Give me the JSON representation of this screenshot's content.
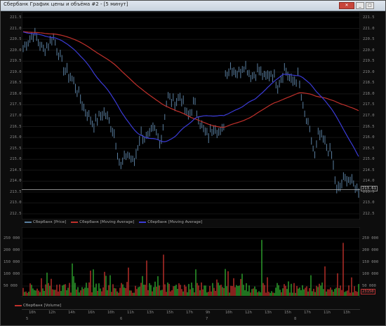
{
  "window": {
    "title": "Сбербанк График цены и объёма #2 - [5 минут]",
    "btn_min": "_",
    "btn_max": "□",
    "btn_close": "✕"
  },
  "price_panel": {
    "y_ticks": [
      "221.5",
      "221.0",
      "220.5",
      "220.0",
      "219.5",
      "219.0",
      "218.5",
      "218.0",
      "217.5",
      "217.0",
      "216.5",
      "216.0",
      "215.5",
      "215.0",
      "214.5",
      "214.0",
      "213.5",
      "213.0",
      "212.5"
    ],
    "last_price": "213.61",
    "legend": [
      {
        "label": "Сбербанк [Price]",
        "color": "#5a7fa0"
      },
      {
        "label": "Сбербанк [Moving Average]",
        "color": "#c0302b"
      },
      {
        "label": "Сбербанк [Moving Average]",
        "color": "#3b3bd6"
      }
    ]
  },
  "volume_panel": {
    "y_ticks": [
      "250 000",
      "200 000",
      "150 000",
      "100 000",
      "50 000"
    ],
    "last_volume": "23150",
    "legend": {
      "label": "Сбербанк [Volume]",
      "color": "#c0302b"
    }
  },
  "time_axis": {
    "labels": [
      "10h",
      "12h",
      "14h",
      "16h",
      "10h",
      "11h",
      "13h",
      "15h",
      "17h",
      "9h",
      "10h",
      "12h",
      "13h",
      "15h",
      "17h",
      "11h",
      "13h"
    ],
    "dates": [
      "5",
      "6",
      "7",
      "8"
    ]
  },
  "chart_data": {
    "type": "line",
    "series": [
      {
        "name": "Сбербанк [Price]",
        "color": "#5a7fa0"
      },
      {
        "name": "Сбербанк [Moving Average]",
        "color": "#c0302b"
      },
      {
        "name": "Сбербанк [Moving Average]",
        "color": "#3b3bd6"
      },
      {
        "name": "Сбербанк [Volume]",
        "color": "#c0302b"
      }
    ],
    "ylim": [
      212.5,
      221.5
    ]
  }
}
